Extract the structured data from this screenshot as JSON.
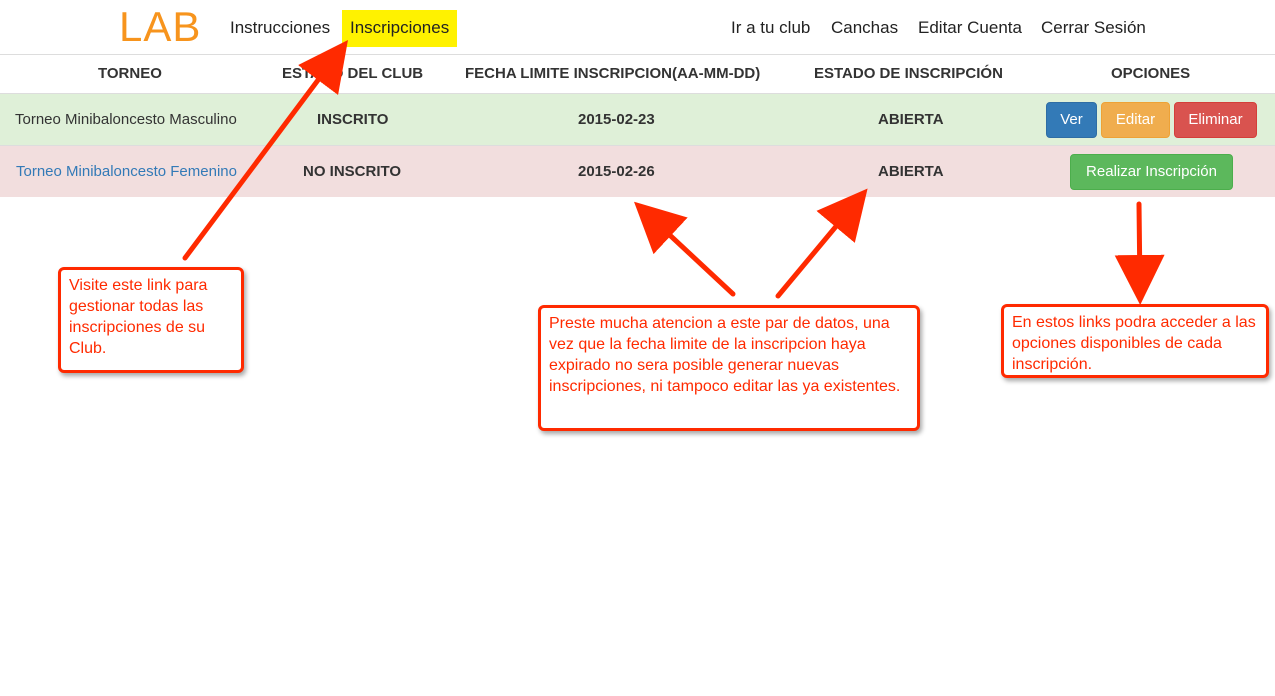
{
  "brand": "LAB",
  "nav": {
    "left": [
      "Instrucciones",
      "Inscripciones"
    ],
    "right": [
      "Ir a tu club",
      "Canchas",
      "Editar Cuenta",
      "Cerrar Sesión"
    ]
  },
  "table": {
    "headers": [
      "TORNEO",
      "ESTADO DEL CLUB",
      "FECHA LIMITE INSCRIPCION(AA-MM-DD)",
      "ESTADO DE INSCRIPCIÓN",
      "OPCIONES"
    ],
    "rows": [
      {
        "torneo": "Torneo Minibaloncesto Masculino",
        "estado_club": "INSCRITO",
        "fecha": "2015-02-23",
        "estado_inscripcion": "ABIERTA",
        "actions": [
          "Ver",
          "Editar",
          "Eliminar"
        ]
      },
      {
        "torneo": "Torneo Minibaloncesto Femenino",
        "estado_club": "NO INSCRITO",
        "fecha": "2015-02-26",
        "estado_inscripcion": "ABIERTA",
        "actions": [
          "Realizar Inscripción"
        ]
      }
    ]
  },
  "callouts": {
    "left": "Visite este link para gestionar todas las inscripciones de su Club.",
    "center": "Preste mucha atencion a este par de datos, una vez que la fecha limite de la inscripcion haya expirado no sera posible generar nuevas inscripciones, ni tampoco editar las ya existentes.",
    "right": "En estos links podra acceder a las opciones disponibles de cada inscripción."
  },
  "colors": {
    "brand": "#f7941d",
    "nav_highlight": "#fff200",
    "annotation": "#ff2a00",
    "row_success": "#dff0d8",
    "row_danger": "#f2dede"
  },
  "icons": [
    "arrow-annotation"
  ]
}
